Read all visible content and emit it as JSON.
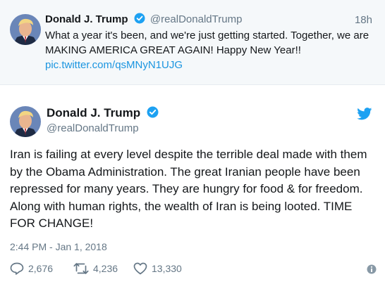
{
  "top_tweet": {
    "name": "Donald J. Trump",
    "handle": "@realDonaldTrump",
    "time_ago": "18h",
    "text": "What a year it's been, and we're just getting started. Together, we are MAKING AMERICA GREAT AGAIN! Happy New Year!!",
    "link": "pic.twitter.com/qsMNyN1UJG",
    "icons": {
      "avatar": "avatar-photo",
      "verified": "verified-badge-icon"
    }
  },
  "main_tweet": {
    "name": "Donald J. Trump",
    "handle": "@realDonaldTrump",
    "text": "Iran is failing at every level despite the terrible deal made with them by the Obama Administration. The great Iranian people have been repressed for many years. They are hungry for food & for freedom. Along with human rights, the wealth of Iran is being looted. TIME FOR CHANGE!",
    "timestamp": "2:44 PM - Jan 1, 2018",
    "replies": "2,676",
    "retweets": "4,236",
    "likes": "13,330",
    "icons": {
      "brand": "twitter-bird-icon",
      "reply": "reply-icon",
      "retweet": "retweet-icon",
      "like": "heart-icon",
      "info": "info-icon"
    }
  },
  "colors": {
    "brand": "#1da1f2",
    "link": "#1b95e0",
    "muted": "#657786",
    "text": "#14171a",
    "top_background": "#f5f8fa"
  }
}
